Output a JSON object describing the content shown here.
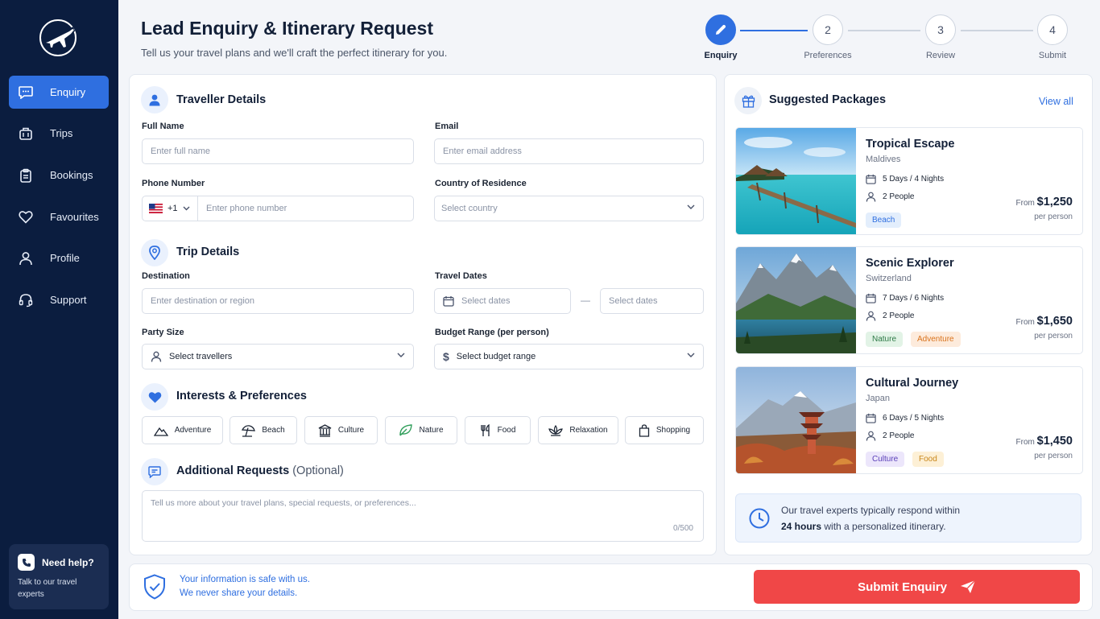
{
  "sidebar": {
    "items": [
      {
        "label": "Enquiry",
        "icon": "chat-icon",
        "active": true
      },
      {
        "label": "Trips",
        "icon": "suitcase-icon"
      },
      {
        "label": "Bookings",
        "icon": "clipboard-icon"
      },
      {
        "label": "Favourites",
        "icon": "heart-icon"
      },
      {
        "label": "Profile",
        "icon": "user-icon"
      },
      {
        "label": "Support",
        "icon": "headset-icon"
      }
    ],
    "help": {
      "title": "Need help?",
      "text": "Talk to our travel experts"
    }
  },
  "header": {
    "title": "Lead Enquiry & Itinerary Request",
    "subtitle": "Tell us your travel plans and we'll craft the perfect itinerary for you."
  },
  "stepper": {
    "steps": [
      {
        "number": "1",
        "label": "Enquiry",
        "active": true
      },
      {
        "number": "2",
        "label": "Preferences"
      },
      {
        "number": "3",
        "label": "Review"
      },
      {
        "number": "4",
        "label": "Submit"
      }
    ]
  },
  "traveller": {
    "title": "Traveller Details",
    "full_name_label": "Full Name",
    "full_name_placeholder": "Enter full name",
    "email_label": "Email",
    "email_placeholder": "Enter email address",
    "phone_label": "Phone Number",
    "phone_code": "+1",
    "phone_placeholder": "Enter phone number",
    "country_label": "Country of Residence",
    "country_placeholder": "Select country"
  },
  "trip": {
    "title": "Trip Details",
    "destination_label": "Destination",
    "destination_placeholder": "Enter destination or region",
    "dates_label": "Travel Dates",
    "start_placeholder": "Select dates",
    "separator": "—",
    "end_placeholder": "Select dates",
    "party_label": "Party Size",
    "party_placeholder": "Select travellers",
    "budget_label": "Budget Range (per person)",
    "budget_placeholder": "Select budget range"
  },
  "interests": {
    "title": "Interests & Preferences",
    "chips": [
      {
        "label": "Adventure",
        "icon": "mountain-icon"
      },
      {
        "label": "Beach",
        "icon": "umbrella-icon"
      },
      {
        "label": "Culture",
        "icon": "temple-icon"
      },
      {
        "label": "Nature",
        "icon": "leaf-icon"
      },
      {
        "label": "Food",
        "icon": "utensils-icon"
      },
      {
        "label": "Relaxation",
        "icon": "lotus-icon"
      },
      {
        "label": "Shopping",
        "icon": "bag-icon"
      }
    ]
  },
  "additional": {
    "title": "Additional Requests",
    "optional": "(Optional)",
    "placeholder": "Tell us more about your travel plans, special requests, or preferences...",
    "counter": "0/500"
  },
  "footer": {
    "safe_line1": "Your information is safe with us.",
    "safe_line2": "We never share your details.",
    "submit_label": "Submit Enquiry"
  },
  "packages": {
    "title": "Suggested Packages",
    "view_all": "View all",
    "items": [
      {
        "name": "Tropical Escape",
        "location": "Maldives",
        "duration": "5 Days / 4 Nights",
        "people": "2 People",
        "from": "From",
        "price": "$1,250",
        "per": "per person",
        "tags": [
          "Beach"
        ]
      },
      {
        "name": "Scenic Explorer",
        "location": "Switzerland",
        "duration": "7 Days / 6 Nights",
        "people": "2 People",
        "from": "From",
        "price": "$1,650",
        "per": "per person",
        "tags": [
          "Nature",
          "Adventure"
        ]
      },
      {
        "name": "Cultural Journey",
        "location": "Japan",
        "duration": "6 Days / 5 Nights",
        "people": "2 People",
        "from": "From",
        "price": "$1,450",
        "per": "per person",
        "tags": [
          "Culture",
          "Food"
        ]
      }
    ],
    "info_line1": "Our travel experts typically respond within",
    "info_bold": "24 hours",
    "info_line2": "with a personalized itinerary."
  },
  "colors": {
    "sidebar": "#0b1d3f",
    "accent": "#2f6fe0",
    "submit": "#f04747"
  }
}
